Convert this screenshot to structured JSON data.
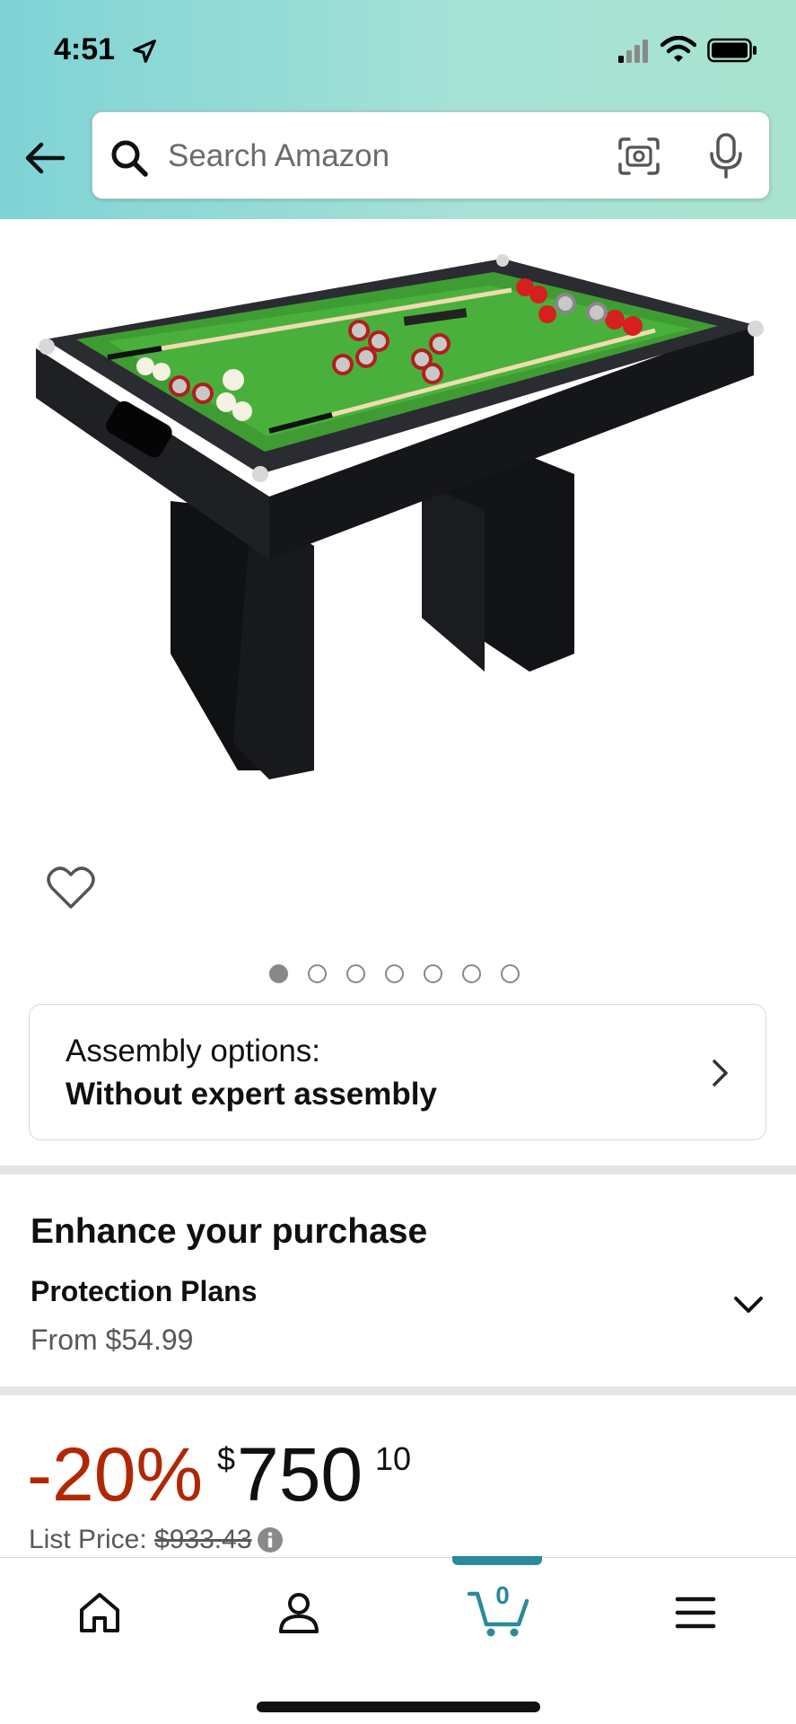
{
  "status_bar": {
    "time": "4:51"
  },
  "search": {
    "placeholder": "Search Amazon"
  },
  "product": {
    "image_alt": "Bumper pool table",
    "image_count": 7,
    "active_image_index": 0
  },
  "assembly": {
    "label": "Assembly options:",
    "value": "Without expert assembly"
  },
  "enhance": {
    "title": "Enhance your purchase",
    "plans_title": "Protection Plans",
    "plans_price": "From $54.99"
  },
  "price": {
    "discount": "-20%",
    "symbol": "$",
    "whole": "750",
    "fraction": "10",
    "list_label": "List Price:",
    "list_value": "$933.43"
  },
  "nav": {
    "cart_count": "0"
  },
  "colors": {
    "discount_red": "#b12704",
    "accent_teal": "#2a8a9c"
  }
}
